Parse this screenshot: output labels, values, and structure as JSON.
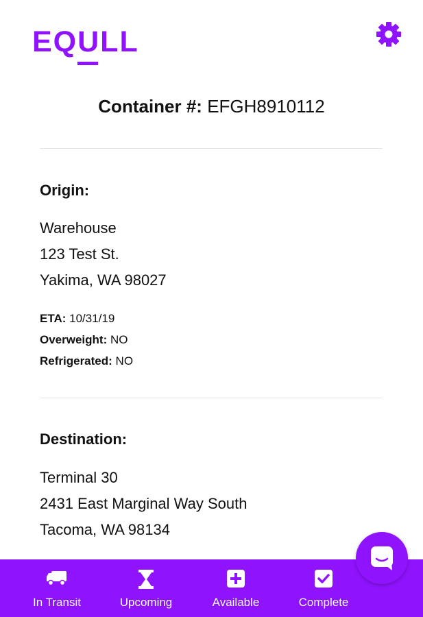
{
  "app": {
    "logo_text": "EQULL"
  },
  "header": {
    "settings_icon": "gear-icon"
  },
  "container": {
    "label": "Container #:",
    "number": "EFGH8910112"
  },
  "origin": {
    "title": "Origin:",
    "name": "Warehouse",
    "street": "123 Test St.",
    "city": "Yakima, WA  98027",
    "eta_label": "ETA:",
    "eta_value": "10/31/19",
    "overweight_label": "Overweight:",
    "overweight_value": "NO",
    "refrigerated_label": "Refrigerated:",
    "refrigerated_value": "NO"
  },
  "destination": {
    "title": "Destination:",
    "name": "Terminal 30",
    "street": "2431 East Marginal Way South",
    "city": "Tacoma, WA  98134"
  },
  "tabs": [
    {
      "label": "In Transit",
      "icon": "truck-icon"
    },
    {
      "label": "Upcoming",
      "icon": "hourglass-icon"
    },
    {
      "label": "Available",
      "icon": "plus-square-icon"
    },
    {
      "label": "Complete",
      "icon": "check-square-icon"
    }
  ],
  "chat": {
    "icon": "chat-icon"
  },
  "colors": {
    "brand": "#9013fe",
    "text": "#111111",
    "divider": "#e3e3e3"
  }
}
